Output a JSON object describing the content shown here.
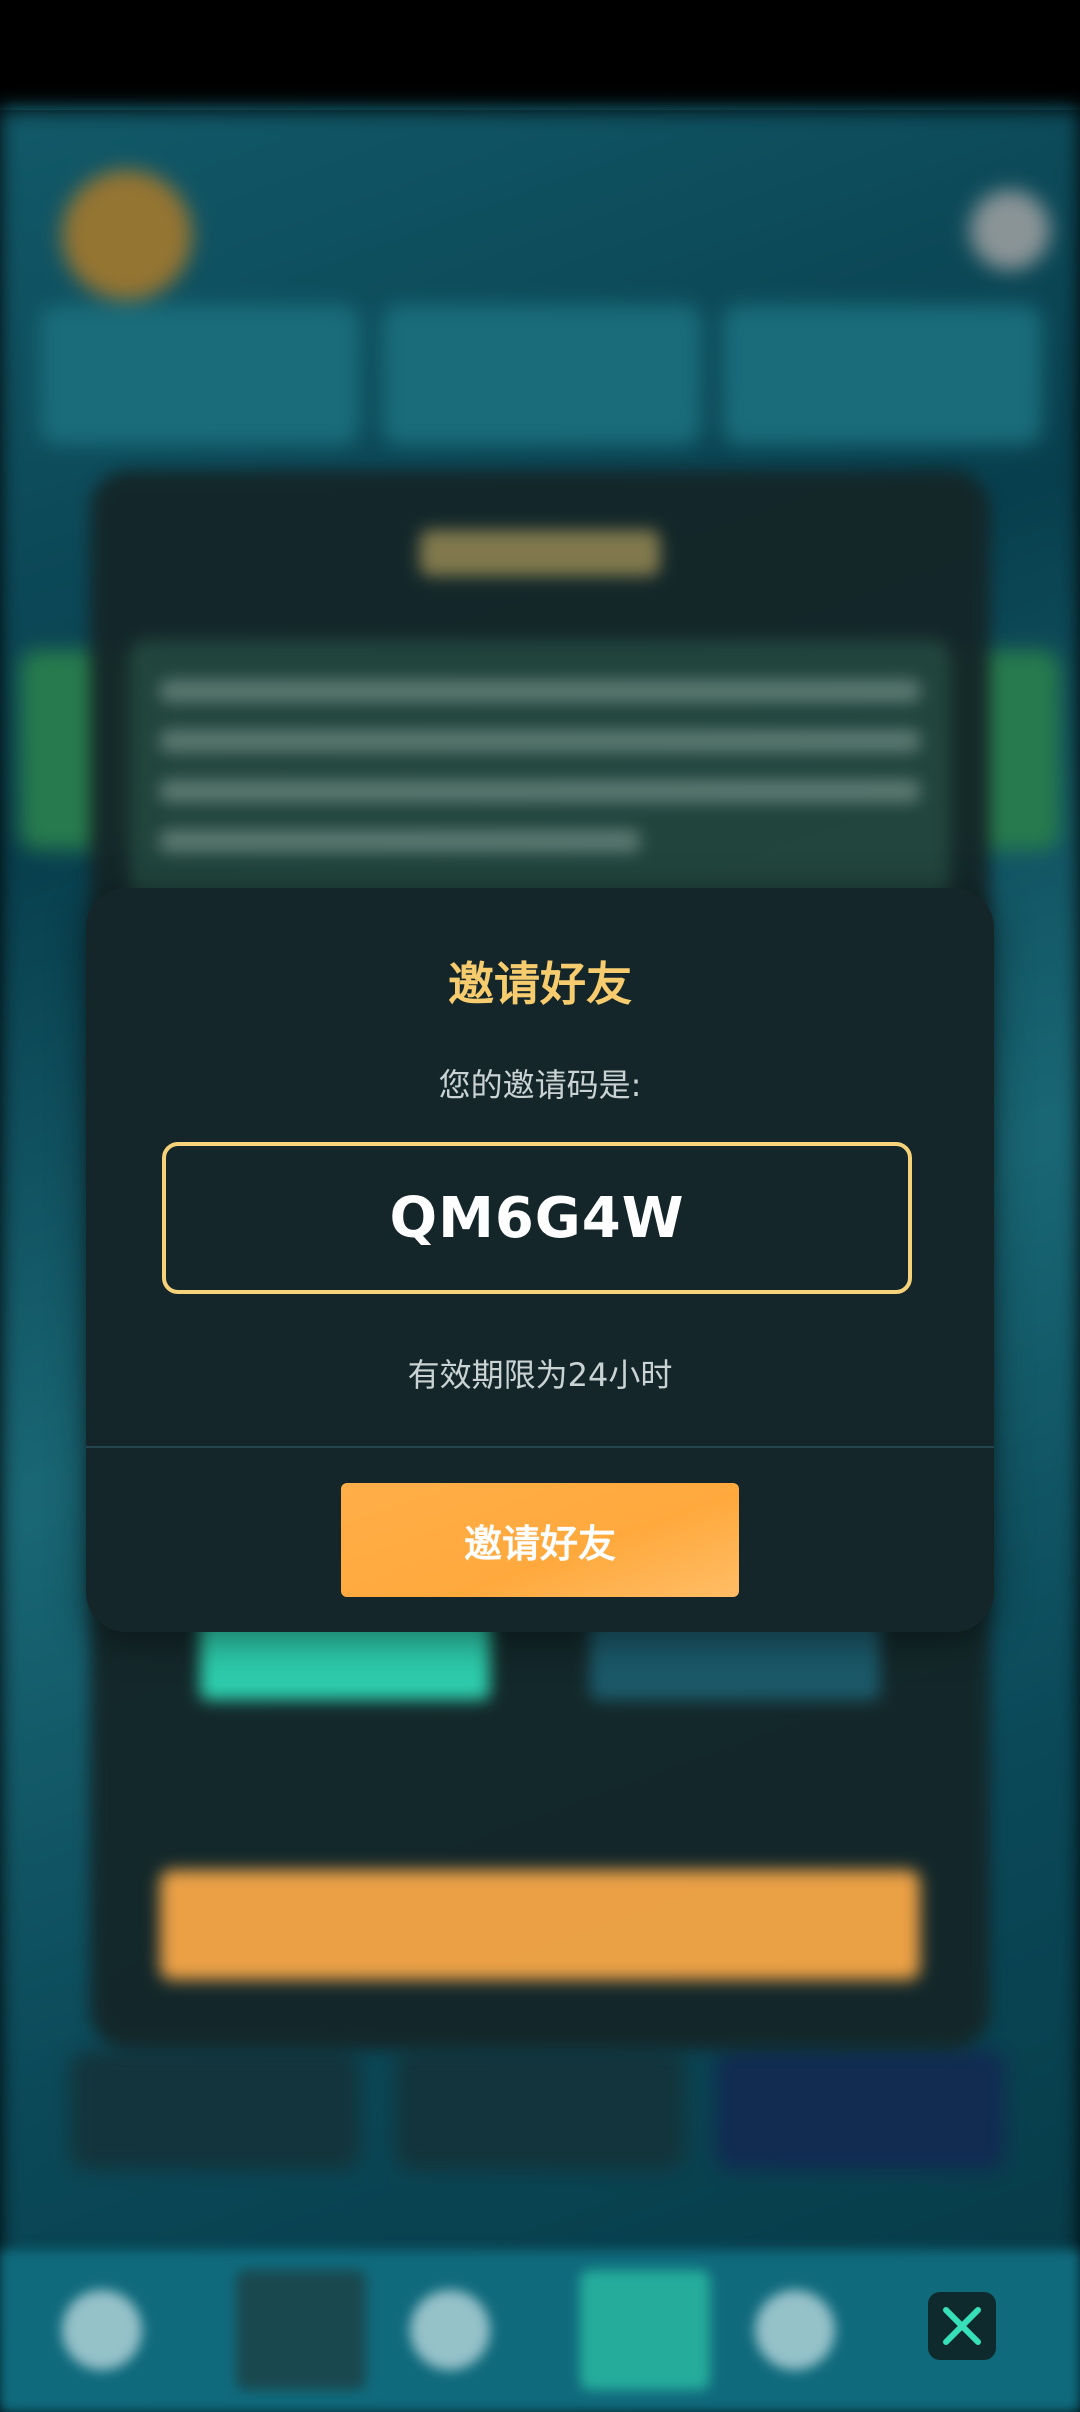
{
  "modal": {
    "title": "邀请好友",
    "subtitle": "您的邀请码是:",
    "invite_code": "QM6G4W",
    "validity_text": "有效期限为24小时",
    "invite_button_label": "邀请好友"
  },
  "colors": {
    "title_gold": "#f6cc6e",
    "code_border": "#f6d27b",
    "button_orange": "#ffa93d",
    "modal_bg": "#15262a"
  },
  "icons": {
    "close": "close-icon"
  }
}
